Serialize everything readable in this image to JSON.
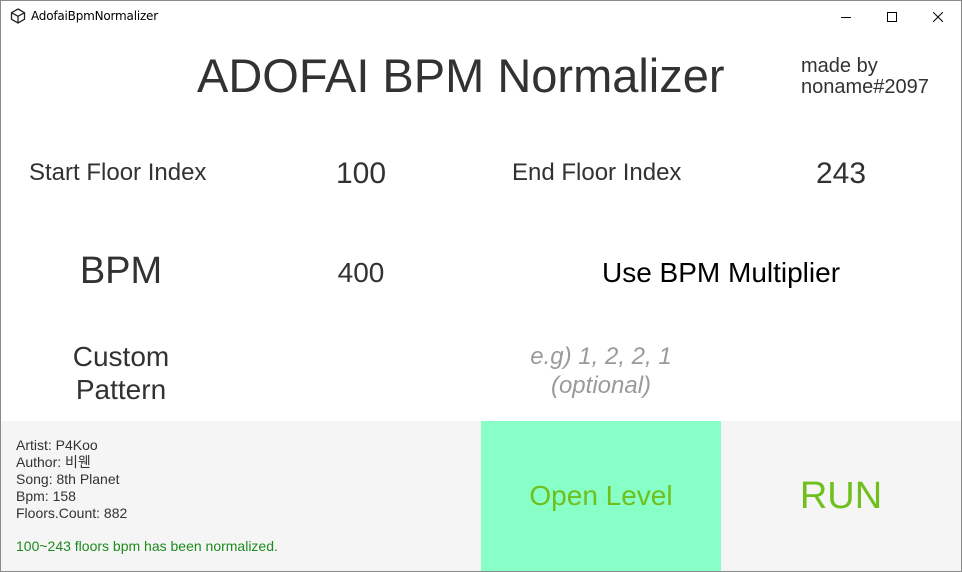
{
  "window": {
    "title": "AdofaiBpmNormalizer",
    "icon": "unity-icon",
    "controls": [
      "minimize-icon",
      "maximize-icon",
      "close-icon"
    ]
  },
  "header": {
    "title": "ADOFAI BPM Normalizer",
    "credit_line1": "made by",
    "credit_line2": "noname#2097"
  },
  "fields": {
    "start_floor_label": "Start Floor Index",
    "start_floor_value": "100",
    "end_floor_label": "End Floor Index",
    "end_floor_value": "243",
    "bpm_label": "BPM",
    "bpm_value": "400",
    "multiplier_label": "Use BPM Multiplier",
    "custom_pattern_label_line1": "Custom",
    "custom_pattern_label_line2": "Pattern",
    "custom_pattern_placeholder": "e.g) 1, 2, 2, 1\n(optional)"
  },
  "info": {
    "artist": "Artist: P4Koo",
    "author": "Author: 비웬",
    "song": "Song: 8th Planet",
    "bpm": "Bpm: 158",
    "floors": "Floors.Count: 882",
    "status": "100~243 floors bpm has been normalized."
  },
  "buttons": {
    "open_level": "Open Level",
    "run": "RUN"
  },
  "colors": {
    "open_button_bg": "#87ffc7",
    "button_text": "#6fc01c",
    "status_text": "#1e8a1e",
    "panel_bg": "#f5f5f5"
  }
}
